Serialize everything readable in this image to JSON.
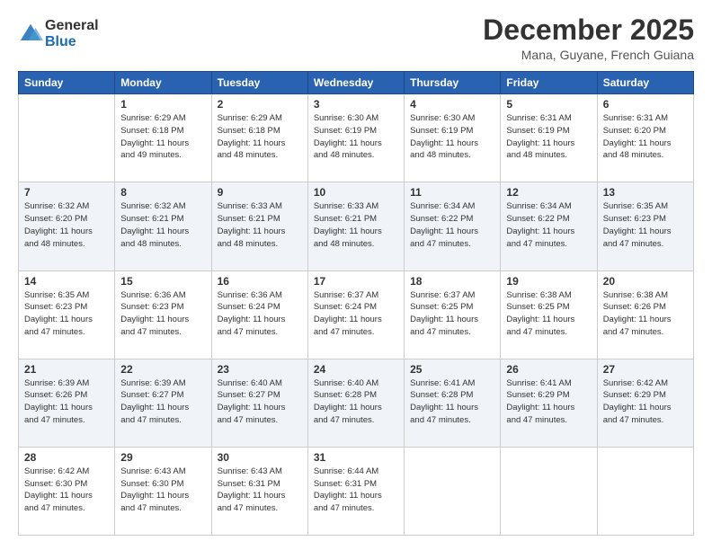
{
  "header": {
    "logo_line1": "General",
    "logo_line2": "Blue",
    "month_title": "December 2025",
    "subtitle": "Mana, Guyane, French Guiana"
  },
  "days_of_week": [
    "Sunday",
    "Monday",
    "Tuesday",
    "Wednesday",
    "Thursday",
    "Friday",
    "Saturday"
  ],
  "weeks": [
    [
      {
        "day": "",
        "info": ""
      },
      {
        "day": "1",
        "info": "Sunrise: 6:29 AM\nSunset: 6:18 PM\nDaylight: 11 hours\nand 49 minutes."
      },
      {
        "day": "2",
        "info": "Sunrise: 6:29 AM\nSunset: 6:18 PM\nDaylight: 11 hours\nand 48 minutes."
      },
      {
        "day": "3",
        "info": "Sunrise: 6:30 AM\nSunset: 6:19 PM\nDaylight: 11 hours\nand 48 minutes."
      },
      {
        "day": "4",
        "info": "Sunrise: 6:30 AM\nSunset: 6:19 PM\nDaylight: 11 hours\nand 48 minutes."
      },
      {
        "day": "5",
        "info": "Sunrise: 6:31 AM\nSunset: 6:19 PM\nDaylight: 11 hours\nand 48 minutes."
      },
      {
        "day": "6",
        "info": "Sunrise: 6:31 AM\nSunset: 6:20 PM\nDaylight: 11 hours\nand 48 minutes."
      }
    ],
    [
      {
        "day": "7",
        "info": "Sunrise: 6:32 AM\nSunset: 6:20 PM\nDaylight: 11 hours\nand 48 minutes."
      },
      {
        "day": "8",
        "info": "Sunrise: 6:32 AM\nSunset: 6:21 PM\nDaylight: 11 hours\nand 48 minutes."
      },
      {
        "day": "9",
        "info": "Sunrise: 6:33 AM\nSunset: 6:21 PM\nDaylight: 11 hours\nand 48 minutes."
      },
      {
        "day": "10",
        "info": "Sunrise: 6:33 AM\nSunset: 6:21 PM\nDaylight: 11 hours\nand 48 minutes."
      },
      {
        "day": "11",
        "info": "Sunrise: 6:34 AM\nSunset: 6:22 PM\nDaylight: 11 hours\nand 47 minutes."
      },
      {
        "day": "12",
        "info": "Sunrise: 6:34 AM\nSunset: 6:22 PM\nDaylight: 11 hours\nand 47 minutes."
      },
      {
        "day": "13",
        "info": "Sunrise: 6:35 AM\nSunset: 6:23 PM\nDaylight: 11 hours\nand 47 minutes."
      }
    ],
    [
      {
        "day": "14",
        "info": "Sunrise: 6:35 AM\nSunset: 6:23 PM\nDaylight: 11 hours\nand 47 minutes."
      },
      {
        "day": "15",
        "info": "Sunrise: 6:36 AM\nSunset: 6:23 PM\nDaylight: 11 hours\nand 47 minutes."
      },
      {
        "day": "16",
        "info": "Sunrise: 6:36 AM\nSunset: 6:24 PM\nDaylight: 11 hours\nand 47 minutes."
      },
      {
        "day": "17",
        "info": "Sunrise: 6:37 AM\nSunset: 6:24 PM\nDaylight: 11 hours\nand 47 minutes."
      },
      {
        "day": "18",
        "info": "Sunrise: 6:37 AM\nSunset: 6:25 PM\nDaylight: 11 hours\nand 47 minutes."
      },
      {
        "day": "19",
        "info": "Sunrise: 6:38 AM\nSunset: 6:25 PM\nDaylight: 11 hours\nand 47 minutes."
      },
      {
        "day": "20",
        "info": "Sunrise: 6:38 AM\nSunset: 6:26 PM\nDaylight: 11 hours\nand 47 minutes."
      }
    ],
    [
      {
        "day": "21",
        "info": "Sunrise: 6:39 AM\nSunset: 6:26 PM\nDaylight: 11 hours\nand 47 minutes."
      },
      {
        "day": "22",
        "info": "Sunrise: 6:39 AM\nSunset: 6:27 PM\nDaylight: 11 hours\nand 47 minutes."
      },
      {
        "day": "23",
        "info": "Sunrise: 6:40 AM\nSunset: 6:27 PM\nDaylight: 11 hours\nand 47 minutes."
      },
      {
        "day": "24",
        "info": "Sunrise: 6:40 AM\nSunset: 6:28 PM\nDaylight: 11 hours\nand 47 minutes."
      },
      {
        "day": "25",
        "info": "Sunrise: 6:41 AM\nSunset: 6:28 PM\nDaylight: 11 hours\nand 47 minutes."
      },
      {
        "day": "26",
        "info": "Sunrise: 6:41 AM\nSunset: 6:29 PM\nDaylight: 11 hours\nand 47 minutes."
      },
      {
        "day": "27",
        "info": "Sunrise: 6:42 AM\nSunset: 6:29 PM\nDaylight: 11 hours\nand 47 minutes."
      }
    ],
    [
      {
        "day": "28",
        "info": "Sunrise: 6:42 AM\nSunset: 6:30 PM\nDaylight: 11 hours\nand 47 minutes."
      },
      {
        "day": "29",
        "info": "Sunrise: 6:43 AM\nSunset: 6:30 PM\nDaylight: 11 hours\nand 47 minutes."
      },
      {
        "day": "30",
        "info": "Sunrise: 6:43 AM\nSunset: 6:31 PM\nDaylight: 11 hours\nand 47 minutes."
      },
      {
        "day": "31",
        "info": "Sunrise: 6:44 AM\nSunset: 6:31 PM\nDaylight: 11 hours\nand 47 minutes."
      },
      {
        "day": "",
        "info": ""
      },
      {
        "day": "",
        "info": ""
      },
      {
        "day": "",
        "info": ""
      }
    ]
  ]
}
